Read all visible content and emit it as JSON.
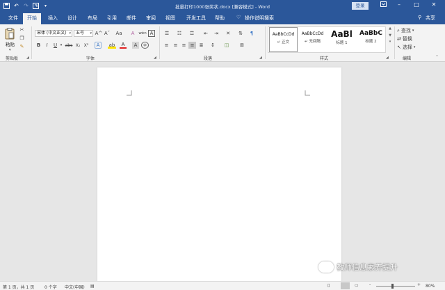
{
  "titlebar": {
    "doc_title": "批量打印1000张奖状.docx [兼容模式] - Word",
    "login_label": "登录",
    "bg_color": "#2b579a"
  },
  "tabs": [
    {
      "label": "文件"
    },
    {
      "label": "开始"
    },
    {
      "label": "插入"
    },
    {
      "label": "设计"
    },
    {
      "label": "布局"
    },
    {
      "label": "引用"
    },
    {
      "label": "邮件"
    },
    {
      "label": "审阅"
    },
    {
      "label": "视图"
    },
    {
      "label": "开发工具"
    },
    {
      "label": "帮助"
    }
  ],
  "tell_me": {
    "label": "操作说明搜索"
  },
  "share": {
    "label": "共享"
  },
  "ribbon": {
    "clipboard": {
      "paste_label": "粘贴",
      "group_label": "剪贴板"
    },
    "font": {
      "font_name": "宋体 (中文正文)",
      "font_size": "五号",
      "group_label": "字体",
      "bold": "B",
      "italic": "I",
      "underline": "U",
      "strike": "abc",
      "subscript": "X₂",
      "superscript": "X²",
      "grow": "A^",
      "shrink": "Aˇ",
      "change_case": "Aa",
      "clear_format": "A",
      "phonetic": "wén",
      "char_border": "A",
      "text_effect": "A",
      "highlight": "ab",
      "font_color": "A",
      "char_shade": "A",
      "enclose": "字"
    },
    "paragraph": {
      "group_label": "段落"
    },
    "styles": {
      "group_label": "样式",
      "items": [
        {
          "sample": "AaBbCcDd",
          "name": "正文",
          "check": "↵"
        },
        {
          "sample": "AaBbCcDd",
          "name": "无间隔",
          "check": "↵"
        },
        {
          "sample": "AaBl",
          "name": "标题 1"
        },
        {
          "sample": "AaBbC",
          "name": "标题 2"
        }
      ]
    },
    "editing": {
      "group_label": "编辑",
      "find": "查找",
      "replace": "替换",
      "select": "选择"
    }
  },
  "statusbar": {
    "page_info": "第 1 页，共 1 页",
    "word_count": "0 个字",
    "language": "中文(中国)",
    "zoom": "80%",
    "zoom_minus": "-",
    "zoom_plus": "+"
  },
  "watermark": {
    "text": "教师信息素养提升"
  },
  "icons": {
    "save": "save-icon",
    "undo": "undo-icon",
    "redo": "redo-icon",
    "touch": "touch-mode-icon",
    "customize": "customize-qat-icon",
    "ribbon_opts": "ribbon-options-icon",
    "minimize": "minimize-icon",
    "maximize": "maximize-icon",
    "close": "close-icon"
  }
}
